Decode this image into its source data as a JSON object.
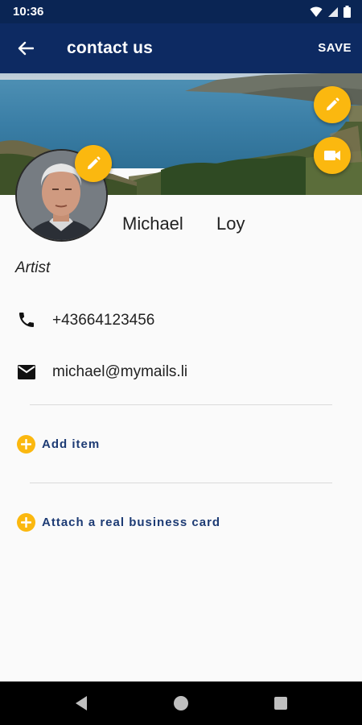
{
  "status_bar": {
    "time": "10:36",
    "icons": [
      "wifi-icon",
      "signal-icon",
      "battery-icon"
    ]
  },
  "app_bar": {
    "title": "contact us",
    "save_label": "SAVE",
    "back_icon": "arrow-back-icon"
  },
  "cover": {
    "image": "coastal bay landscape",
    "edit_icon": "pencil-icon",
    "video_icon": "videocam-icon"
  },
  "profile": {
    "avatar_edit_icon": "pencil-icon",
    "first_name": "Michael",
    "last_name": "Loy",
    "job_title": "Artist"
  },
  "contact_rows": {
    "phone": "+43664123456",
    "email": "michael@mymails.li"
  },
  "actions": {
    "add_item": "Add item",
    "attach_card": "Attach a real business card"
  },
  "nav_bar": {
    "icons": [
      "nav-back-icon",
      "nav-home-icon",
      "nav-recents-icon"
    ]
  },
  "colors": {
    "app_bar": "#0d2a62",
    "status_bar": "#0a2554",
    "accent": "#fbb80f",
    "action_text": "#1d3b74"
  }
}
